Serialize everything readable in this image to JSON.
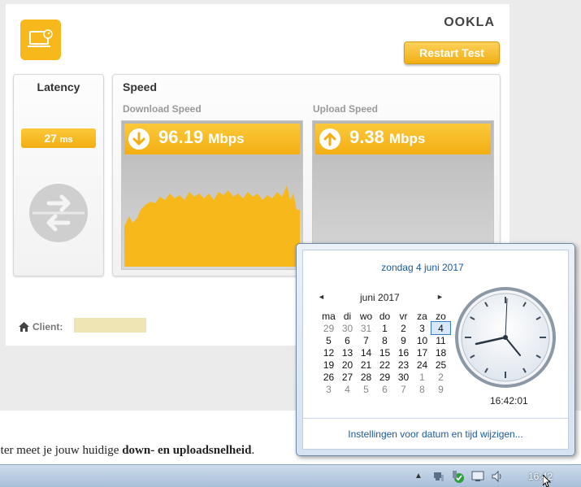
{
  "speedtest": {
    "brand": "OOKLA",
    "restart_label": "Restart Test",
    "latency": {
      "title": "Latency",
      "value": "27",
      "unit": "ms"
    },
    "speed": {
      "title": "Speed",
      "download": {
        "label": "Download Speed",
        "value": "96.19",
        "unit": "Mbps"
      },
      "upload": {
        "label": "Upload Speed",
        "value": "9.38",
        "unit": "Mbps"
      }
    },
    "client_label": "Client:",
    "accent_color": "#f6b81a"
  },
  "article": {
    "text_plain": "eter meet je jouw huidige ",
    "bold_1": "down-",
    "text_mid": " en ",
    "bold_2": "uploadsnelheid",
    "text_end": "."
  },
  "datetime_popup": {
    "long_date": "zondag 4 juni 2017",
    "month_label": "juni 2017",
    "prev_label": "◄",
    "next_label": "►",
    "weekdays": [
      "ma",
      "di",
      "wo",
      "do",
      "vr",
      "za",
      "zo"
    ],
    "weeks": [
      [
        "29",
        "30",
        "31",
        "1",
        "2",
        "3",
        "4"
      ],
      [
        "5",
        "6",
        "7",
        "8",
        "9",
        "10",
        "11"
      ],
      [
        "12",
        "13",
        "14",
        "15",
        "16",
        "17",
        "18"
      ],
      [
        "19",
        "20",
        "21",
        "22",
        "23",
        "24",
        "25"
      ],
      [
        "26",
        "27",
        "28",
        "29",
        "30",
        "1",
        "2"
      ],
      [
        "3",
        "4",
        "5",
        "6",
        "7",
        "8",
        "9"
      ]
    ],
    "today": "4",
    "digital_time": "16:42:01",
    "settings_link": "Instellingen voor datum en tijd wijzigen..."
  },
  "taskbar": {
    "clock": "16:42",
    "tray_icons": [
      "network-icon",
      "security-icon",
      "usb-icon",
      "display-icon",
      "volume-icon"
    ]
  }
}
